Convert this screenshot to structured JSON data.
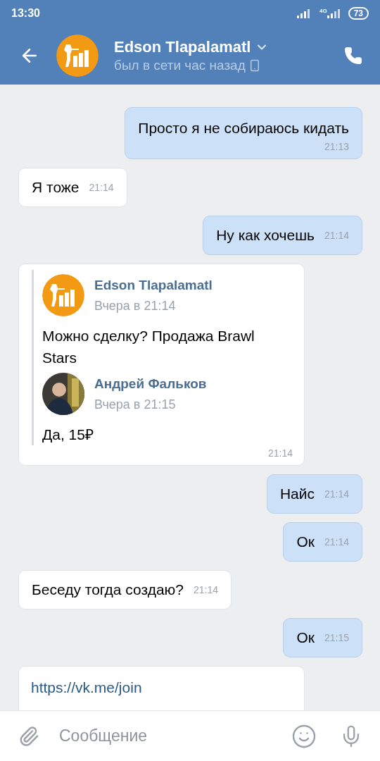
{
  "status_bar": {
    "time": "13:30",
    "battery": "73",
    "network": "4G"
  },
  "header": {
    "name": "Edson Tlapalamatl",
    "status": "был в сети час назад"
  },
  "messages": [
    {
      "kind": "text",
      "outgoing": true,
      "text": "Просто я не собираюсь кидать",
      "time": "21:13"
    },
    {
      "kind": "text",
      "outgoing": false,
      "text": "Я тоже",
      "time": "21:14"
    },
    {
      "kind": "text",
      "outgoing": true,
      "text": "Ну как хочешь",
      "time": "21:14"
    },
    {
      "kind": "forward",
      "outgoing": false,
      "time": "21:14",
      "items": [
        {
          "author": "Edson Tlapalamatl",
          "date": "Вчера в 21:14",
          "kind": "logo",
          "text": "Можно сделку? Продажа Brawl Stars"
        },
        {
          "author": "Андрей Фальков",
          "date": "Вчера в 21:15",
          "text": "Да, 15₽"
        }
      ]
    },
    {
      "kind": "text",
      "outgoing": true,
      "text": "Найс",
      "time": "21:14"
    },
    {
      "kind": "text",
      "outgoing": true,
      "text": "Ок",
      "time": "21:14"
    },
    {
      "kind": "text",
      "outgoing": false,
      "text": "Беседу тогда создаю?",
      "time": "21:14"
    },
    {
      "kind": "text",
      "outgoing": true,
      "text": "Ок",
      "time": "21:15"
    },
    {
      "kind": "link",
      "outgoing": false,
      "text": "https://vk.me/join"
    }
  ],
  "composer": {
    "placeholder": "Сообщение"
  }
}
